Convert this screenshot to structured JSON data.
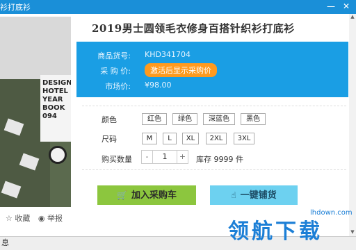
{
  "window": {
    "title": "衫打底衫",
    "minimize": "—",
    "close": "✕"
  },
  "product": {
    "title": "2019男士圆领毛衣修身百搭针织衫打底衫",
    "image_alt": "product photo",
    "book_text": "DESIGN HOTEL YEAR BOOK 094"
  },
  "actions": {
    "favorite": "☆ 收藏",
    "report": "◉ 举报"
  },
  "info": {
    "sku_label": "商品货号:",
    "sku_value": "KHD341704",
    "purchase_label": "采 购 价:",
    "purchase_badge": "激活后显示采购价",
    "market_label": "市场价:",
    "market_value": "¥98.00"
  },
  "attributes": {
    "color_label": "颜色",
    "colors": [
      "红色",
      "绿色",
      "深蓝色",
      "黑色"
    ],
    "size_label": "尺码",
    "sizes": [
      "M",
      "L",
      "XL",
      "2XL",
      "3XL"
    ]
  },
  "quantity": {
    "label": "购买数量",
    "minus": "-",
    "value": "1",
    "plus": "+",
    "stock": "库存 9999 件"
  },
  "buttons": {
    "cart": "加入采购车",
    "cart_icon": "🛒",
    "stock": "一键铺货",
    "stock_icon": "☝"
  },
  "statusbar": {
    "text": "息"
  },
  "watermark": {
    "big": "领航下载",
    "small": "lhdown.com"
  },
  "colors": {
    "titlebar": "#1a8fd8",
    "info_bg": "#1a9ee4",
    "badge": "#ff9a1e",
    "cart": "#8cc63e",
    "stock": "#6dd1f0"
  }
}
